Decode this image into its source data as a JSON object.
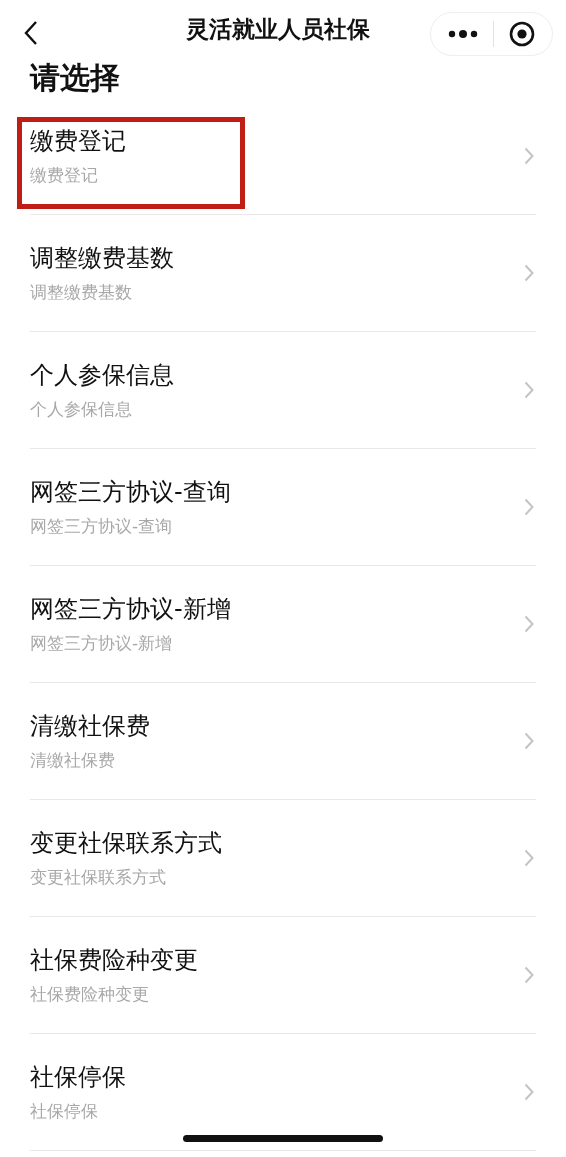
{
  "nav_bar": {
    "title": "灵活就业人员社保"
  },
  "heading": "请选择",
  "items": [
    {
      "title": "缴费登记",
      "subtitle": "缴费登记",
      "highlighted": true
    },
    {
      "title": "调整缴费基数",
      "subtitle": "调整缴费基数",
      "highlighted": false
    },
    {
      "title": "个人参保信息",
      "subtitle": "个人参保信息",
      "highlighted": false
    },
    {
      "title": "网签三方协议-查询",
      "subtitle": "网签三方协议-查询",
      "highlighted": false
    },
    {
      "title": "网签三方协议-新增",
      "subtitle": "网签三方协议-新增",
      "highlighted": false
    },
    {
      "title": "清缴社保费",
      "subtitle": "清缴社保费",
      "highlighted": false
    },
    {
      "title": "变更社保联系方式",
      "subtitle": "变更社保联系方式",
      "highlighted": false
    },
    {
      "title": "社保费险种变更",
      "subtitle": "社保费险种变更",
      "highlighted": false
    },
    {
      "title": "社保停保",
      "subtitle": "社保停保",
      "highlighted": false
    }
  ]
}
